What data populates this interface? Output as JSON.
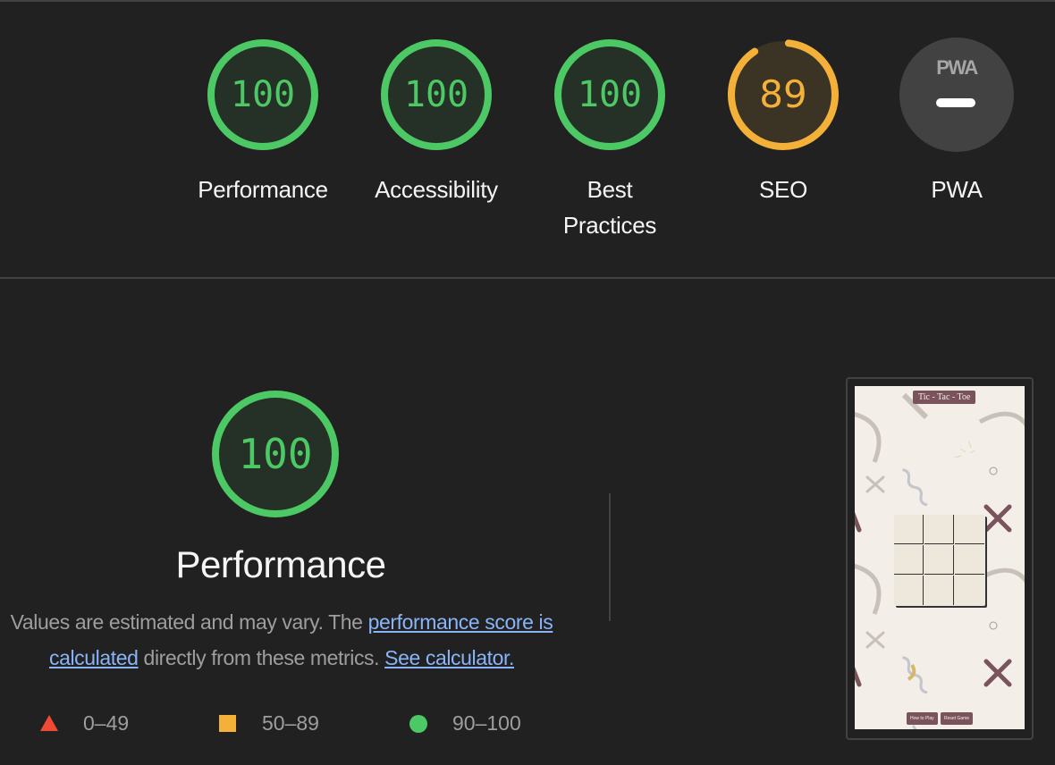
{
  "colors": {
    "pass": "#4cc964",
    "average": "#f3b13a",
    "fail": "#f04a36",
    "na": "#424242",
    "link": "#8ab4f8",
    "background": "#212121"
  },
  "summary": {
    "categories": [
      {
        "id": "performance",
        "label": "Performance",
        "score": "100",
        "rating": "pass",
        "fraction": 1.0
      },
      {
        "id": "accessibility",
        "label": "Accessibility",
        "score": "100",
        "rating": "pass",
        "fraction": 1.0
      },
      {
        "id": "best-practices",
        "label": "Best Practices",
        "label_line1": "Best",
        "label_line2": "Practices",
        "score": "100",
        "rating": "pass",
        "fraction": 1.0
      },
      {
        "id": "seo",
        "label": "SEO",
        "score": "89",
        "rating": "average",
        "fraction": 0.89
      },
      {
        "id": "pwa",
        "label": "PWA",
        "score": "—",
        "rating": "na",
        "badge_text": "PWA"
      }
    ]
  },
  "performance_section": {
    "score": "100",
    "fraction": 1.0,
    "title": "Performance",
    "description_prefix": "Values are estimated and may vary. The ",
    "link1": "performance score is calculated",
    "description_middle": " directly from these metrics. ",
    "link2": "See calculator.",
    "legend": [
      {
        "icon": "triangle-fail-icon",
        "range": "0–49"
      },
      {
        "icon": "square-average-icon",
        "range": "50–89"
      },
      {
        "icon": "circle-pass-icon",
        "range": "90–100"
      }
    ]
  },
  "final_screenshot": {
    "app_title": "Tic - Tac - Toe",
    "buttons": [
      "How to Play",
      "Reset Game"
    ]
  }
}
